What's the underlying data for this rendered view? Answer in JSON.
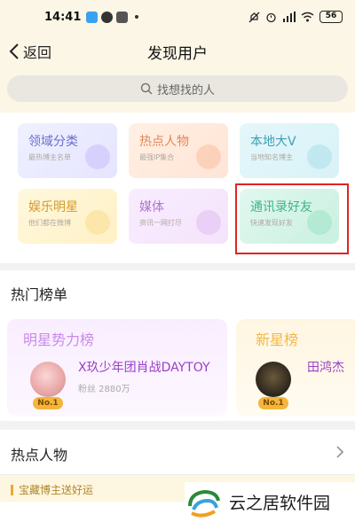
{
  "status_bar": {
    "time": "14:41",
    "battery": "56",
    "icons": [
      "app-icon-blue",
      "app-icon-dark",
      "app-icon-gray",
      "silent-icon",
      "alarm-icon",
      "signal-icon",
      "wifi-icon",
      "battery-icon"
    ]
  },
  "nav": {
    "back_label": "返回",
    "title": "发现用户"
  },
  "search": {
    "placeholder": "找想找的人"
  },
  "categories": [
    {
      "title": "领域分类",
      "subtitle": "最热博主名单"
    },
    {
      "title": "热点人物",
      "subtitle": "最强IP集合"
    },
    {
      "title": "本地大V",
      "subtitle": "当地知名博主"
    },
    {
      "title": "娱乐明星",
      "subtitle": "他们都在微博"
    },
    {
      "title": "媒体",
      "subtitle": "资讯一网打尽"
    },
    {
      "title": "通讯录好友",
      "subtitle": "快速发现好友"
    }
  ],
  "hot_list": {
    "title": "热门榜单",
    "star": {
      "label": "明星势力榜",
      "badge": "No.1",
      "name": "X玖少年团肖战DAYTOY",
      "fans": "粉丝 2880万"
    },
    "new_star": {
      "label": "新星榜",
      "badge": "No.1",
      "name": "田鸿杰"
    }
  },
  "hot_people": {
    "title": "热点人物",
    "promo": "宝藏博主送好运"
  },
  "watermark": {
    "text": "云之居软件园"
  },
  "colors": {
    "highlight": "#e02424",
    "accent_purple": "#9a3fc7",
    "accent_gold": "#f4b53a"
  }
}
